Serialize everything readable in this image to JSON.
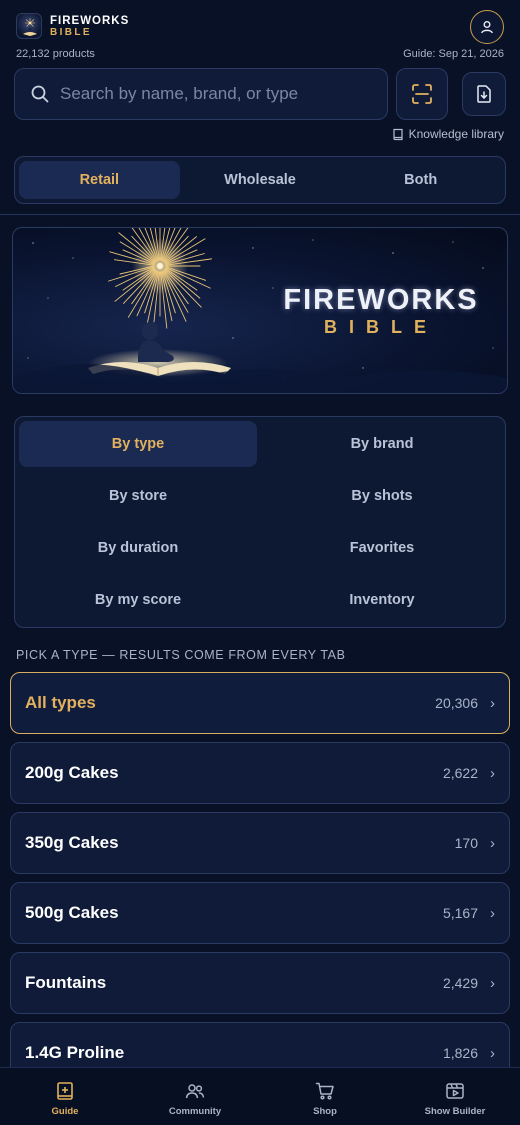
{
  "header": {
    "brand_line1": "FIREWORKS",
    "brand_line2": "BIBLE",
    "product_count": "22,132 products",
    "guide_date": "Guide: Sep 21, 2026"
  },
  "search": {
    "placeholder": "Search by name, brand, or type",
    "value": ""
  },
  "knowledge_link": "Knowledge library",
  "market_tabs": [
    {
      "label": "Retail",
      "active": true
    },
    {
      "label": "Wholesale",
      "active": false
    },
    {
      "label": "Both",
      "active": false
    }
  ],
  "banner": {
    "title": "FIREWORKS",
    "subtitle": "BIBLE"
  },
  "browse_options": [
    {
      "label": "By type",
      "active": true
    },
    {
      "label": "By brand",
      "active": false
    },
    {
      "label": "By store",
      "active": false
    },
    {
      "label": "By shots",
      "active": false
    },
    {
      "label": "By duration",
      "active": false
    },
    {
      "label": "Favorites",
      "active": false
    },
    {
      "label": "By my score",
      "active": false
    },
    {
      "label": "Inventory",
      "active": false
    }
  ],
  "section_label": "PICK A TYPE — RESULTS COME FROM EVERY TAB",
  "types": [
    {
      "name": "All types",
      "count": "20,306",
      "active": true
    },
    {
      "name": "200g Cakes",
      "count": "2,622",
      "active": false
    },
    {
      "name": "350g Cakes",
      "count": "170",
      "active": false
    },
    {
      "name": "500g Cakes",
      "count": "5,167",
      "active": false
    },
    {
      "name": "Fountains",
      "count": "2,429",
      "active": false
    },
    {
      "name": "1.4G Proline",
      "count": "1,826",
      "active": false
    }
  ],
  "bottom_nav": [
    {
      "label": "Guide",
      "icon": "book-plus-icon",
      "active": true
    },
    {
      "label": "Community",
      "icon": "people-icon",
      "active": false
    },
    {
      "label": "Shop",
      "icon": "cart-icon",
      "active": false
    },
    {
      "label": "Show Builder",
      "icon": "film-play-icon",
      "active": false
    }
  ],
  "colors": {
    "background": "#081126",
    "accent_gold": "#e3b15e",
    "panel": "#0f1b38",
    "border": "#2b3a62"
  }
}
